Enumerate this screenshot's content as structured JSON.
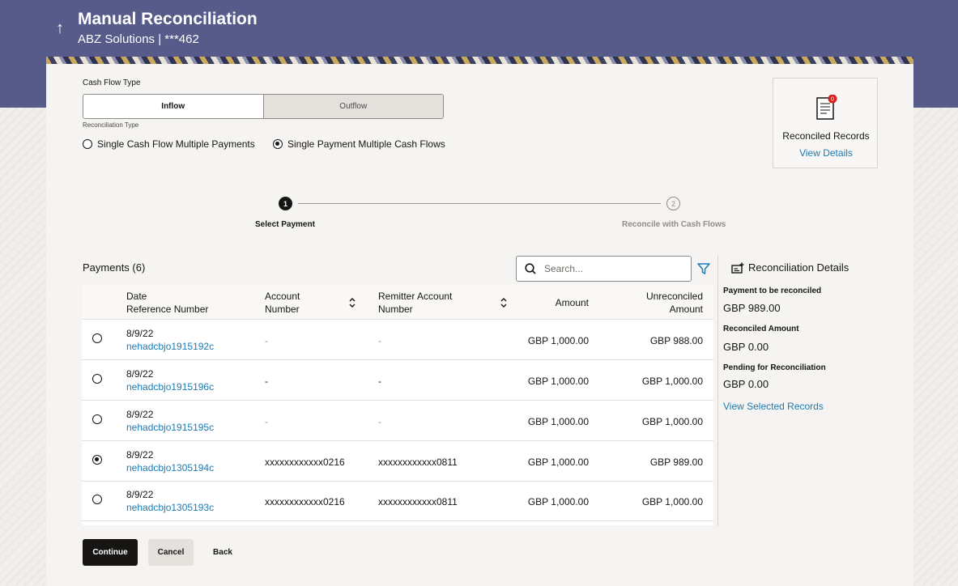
{
  "header": {
    "title": "Manual Reconciliation",
    "subtitle": "ABZ Solutions | ***462",
    "back_icon": "arrow-up-icon"
  },
  "form": {
    "cash_flow_type_label": "Cash Flow Type",
    "cash_flow_options": [
      "Inflow",
      "Outflow"
    ],
    "cash_flow_selected": "Inflow",
    "reconciliation_type_label": "Reconciliation Type",
    "reconciliation_options": [
      "Single Cash Flow Multiple Payments",
      "Single Payment Multiple Cash Flows"
    ],
    "reconciliation_selected": "Single Payment Multiple Cash Flows"
  },
  "reconciled_records": {
    "icon": "document-icon",
    "badge": "0",
    "title": "Reconciled Records",
    "link": "View Details"
  },
  "stepper": {
    "steps": [
      {
        "number": "1",
        "label": "Select Payment",
        "active": true
      },
      {
        "number": "2",
        "label": "Reconcile with Cash Flows",
        "active": false
      }
    ]
  },
  "payments": {
    "title": "Payments (6)",
    "search_placeholder": "Search...",
    "columns": {
      "date": "Date",
      "ref": "Reference Number",
      "account_1": "Account",
      "account_2": "Number",
      "remitter_1": "Remitter Account",
      "remitter_2": "Number",
      "amount": "Amount",
      "unreconciled_1": "Unreconciled",
      "unreconciled_2": "Amount"
    },
    "rows": [
      {
        "date": "8/9/22",
        "ref": "nehadcbjo1915192c",
        "account": "-",
        "remitter": "-",
        "amount": "GBP 1,000.00",
        "unreconciled": "GBP 988.00",
        "selected": false,
        "muted": true
      },
      {
        "date": "8/9/22",
        "ref": "nehadcbjo1915196c",
        "account": "-",
        "remitter": "-",
        "amount": "GBP 1,000.00",
        "unreconciled": "GBP 1,000.00",
        "selected": false,
        "muted": false
      },
      {
        "date": "8/9/22",
        "ref": "nehadcbjo1915195c",
        "account": "-",
        "remitter": "-",
        "amount": "GBP 1,000.00",
        "unreconciled": "GBP 1,000.00",
        "selected": false,
        "muted": true
      },
      {
        "date": "8/9/22",
        "ref": "nehadcbjo1305194c",
        "account": "xxxxxxxxxxxx0216",
        "remitter": "xxxxxxxxxxxx0811",
        "amount": "GBP 1,000.00",
        "unreconciled": "GBP 989.00",
        "selected": true,
        "muted": false
      },
      {
        "date": "8/9/22",
        "ref": "nehadcbjo1305193c",
        "account": "xxxxxxxxxxxx0216",
        "remitter": "xxxxxxxxxxxx0811",
        "amount": "GBP 1,000.00",
        "unreconciled": "GBP 1,000.00",
        "selected": false,
        "muted": false
      }
    ]
  },
  "reconciliation_details": {
    "title": "Reconciliation Details",
    "payment_label": "Payment to be reconciled",
    "payment_value": "GBP 989.00",
    "reconciled_label": "Reconciled Amount",
    "reconciled_value": "GBP 0.00",
    "pending_label": "Pending for Reconciliation",
    "pending_value": "GBP 0.00",
    "link": "View Selected Records"
  },
  "actions": {
    "continue": "Continue",
    "cancel": "Cancel",
    "back": "Back"
  },
  "colors": {
    "header_bg": "#565b8a",
    "link": "#1d7ab3",
    "primary_button": "#161513",
    "badge": "#d9231d"
  }
}
